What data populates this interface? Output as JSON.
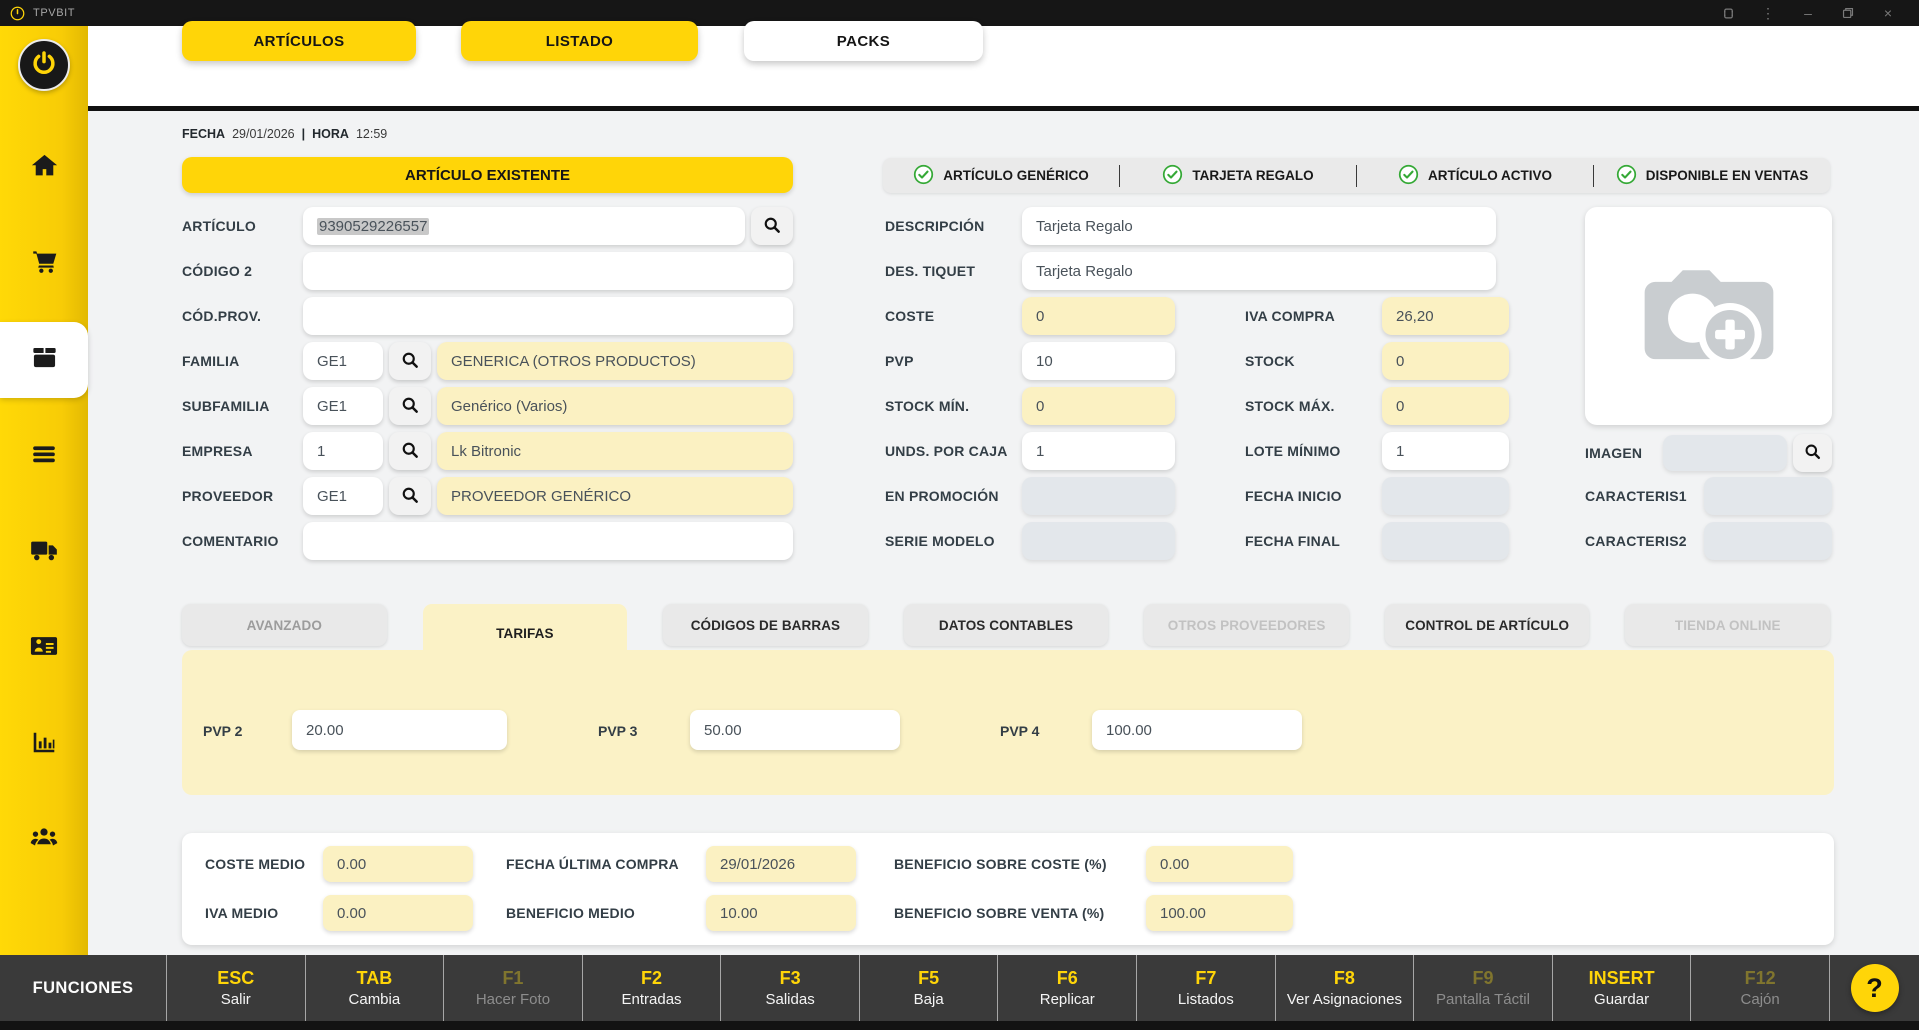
{
  "app": {
    "title": "TPVBIT"
  },
  "header": {
    "nav_buttons": [
      {
        "label": "ARTÍCULOS",
        "style": "yellow"
      },
      {
        "label": "LISTADO",
        "style": "yellow"
      },
      {
        "label": "PACKS",
        "style": "white"
      }
    ]
  },
  "sidebar": {
    "items": [
      {
        "icon": "home"
      },
      {
        "icon": "shopping-cart"
      },
      {
        "icon": "box",
        "active": true
      },
      {
        "icon": "menu-lines"
      },
      {
        "icon": "truck"
      },
      {
        "icon": "id-card"
      },
      {
        "icon": "bar-chart"
      },
      {
        "icon": "users"
      }
    ]
  },
  "info": {
    "fecha_label": "FECHA",
    "fecha": "29/01/2026",
    "divider": "|",
    "hora_label": "HORA",
    "hora": "12:59"
  },
  "banner": {
    "label": "ARTÍCULO EXISTENTE"
  },
  "flags": [
    {
      "label": "ARTÍCULO GENÉRICO",
      "checked": true
    },
    {
      "label": "TARJETA REGALO",
      "checked": true
    },
    {
      "label": "ARTÍCULO ACTIVO",
      "checked": true
    },
    {
      "label": "DISPONIBLE EN VENTAS",
      "checked": true
    }
  ],
  "form_left": {
    "articulo": {
      "label": "ARTÍCULO",
      "value": "9390529226557"
    },
    "codigo2": {
      "label": "CÓDIGO 2",
      "value": ""
    },
    "codprov": {
      "label": "CÓD.PROV.",
      "value": ""
    },
    "familia": {
      "label": "FAMILIA",
      "code": "GE1",
      "desc": "GENERICA (OTROS PRODUCTOS)"
    },
    "subfamilia": {
      "label": "SUBFAMILIA",
      "code": "GE1",
      "desc": "Genérico (Varios)"
    },
    "empresa": {
      "label": "EMPRESA",
      "code": "1",
      "desc": "Lk Bitronic"
    },
    "proveedor": {
      "label": "PROVEEDOR",
      "code": "GE1",
      "desc": "PROVEEDOR GENÉRICO"
    },
    "comentario": {
      "label": "COMENTARIO",
      "value": ""
    }
  },
  "form_mid": {
    "descripcion": {
      "label": "DESCRIPCIÓN",
      "value": "Tarjeta Regalo"
    },
    "des_tiquet": {
      "label": "DES. TIQUET",
      "value": "Tarjeta Regalo"
    },
    "coste": {
      "label": "COSTE",
      "value": "0"
    },
    "iva_compra": {
      "label": "IVA COMPRA",
      "value": "26,20"
    },
    "pvp": {
      "label": "PVP",
      "value": "10"
    },
    "stock": {
      "label": "STOCK",
      "value": "0"
    },
    "stock_min": {
      "label": "STOCK MÍN.",
      "value": "0"
    },
    "stock_max": {
      "label": "STOCK MÁX.",
      "value": "0"
    },
    "unds_caja": {
      "label": "UNDS. POR CAJA",
      "value": "1"
    },
    "lote_min": {
      "label": "LOTE MÍNIMO",
      "value": "1"
    },
    "en_promocion": {
      "label": "EN PROMOCIÓN",
      "value": ""
    },
    "fecha_inicio": {
      "label": "FECHA INICIO",
      "value": ""
    },
    "serie_modelo": {
      "label": "SERIE MODELO",
      "value": ""
    },
    "fecha_final": {
      "label": "FECHA FINAL",
      "value": ""
    }
  },
  "image_panel": {
    "imagen": {
      "label": "IMAGEN",
      "value": ""
    },
    "caracteris1": {
      "label": "CARACTERIS1",
      "value": ""
    },
    "caracteris2": {
      "label": "CARACTERIS2",
      "value": ""
    }
  },
  "detail_tabs": [
    {
      "label": "AVANZADO",
      "state": "muted"
    },
    {
      "label": "TARIFAS",
      "state": "active"
    },
    {
      "label": "CÓDIGOS DE BARRAS",
      "state": "normal"
    },
    {
      "label": "DATOS CONTABLES",
      "state": "normal"
    },
    {
      "label": "OTROS PROVEEDORES",
      "state": "disabled"
    },
    {
      "label": "CONTROL DE ARTÍCULO",
      "state": "normal"
    },
    {
      "label": "TIENDA ONLINE",
      "state": "disabled"
    }
  ],
  "tarifas": [
    {
      "label": "PVP 2",
      "value": "20.00"
    },
    {
      "label": "PVP 3",
      "value": "50.00"
    },
    {
      "label": "PVP 4",
      "value": "100.00"
    }
  ],
  "stats": {
    "row1": [
      {
        "label": "COSTE MEDIO",
        "value": "0.00"
      },
      {
        "label": "FECHA ÚLTIMA COMPRA",
        "value": "29/01/2026"
      },
      {
        "label": "BENEFICIO SOBRE COSTE (%)",
        "value": "0.00"
      }
    ],
    "row2": [
      {
        "label": "IVA MEDIO",
        "value": "0.00"
      },
      {
        "label": "BENEFICIO MEDIO",
        "value": "10.00"
      },
      {
        "label": "BENEFICIO SOBRE VENTA (%)",
        "value": "100.00"
      }
    ]
  },
  "function_bar": {
    "title": "FUNCIONES",
    "keys": [
      {
        "key": "ESC",
        "label": "Salir",
        "disabled": false
      },
      {
        "key": "TAB",
        "label": "Cambia",
        "disabled": false
      },
      {
        "key": "F1",
        "label": "Hacer Foto",
        "disabled": true
      },
      {
        "key": "F2",
        "label": "Entradas",
        "disabled": false
      },
      {
        "key": "F3",
        "label": "Salidas",
        "disabled": false
      },
      {
        "key": "F5",
        "label": "Baja",
        "disabled": false
      },
      {
        "key": "F6",
        "label": "Replicar",
        "disabled": false
      },
      {
        "key": "F7",
        "label": "Listados",
        "disabled": false
      },
      {
        "key": "F8",
        "label": "Ver Asignaciones",
        "disabled": false
      },
      {
        "key": "F9",
        "label": "Pantalla Táctil",
        "disabled": true
      },
      {
        "key": "INSERT",
        "label": "Guardar",
        "disabled": false
      },
      {
        "key": "F12",
        "label": "Cajón",
        "disabled": true
      }
    ],
    "help": "?"
  },
  "colors": {
    "brand_yellow": "#FFD508",
    "input_yellow": "#FBF1C2",
    "panel_yellow": "#FBF2C6",
    "disabled_gray": "#E3E7EB",
    "green_check": "#35A936",
    "bar_dark": "#3A3A3A"
  }
}
